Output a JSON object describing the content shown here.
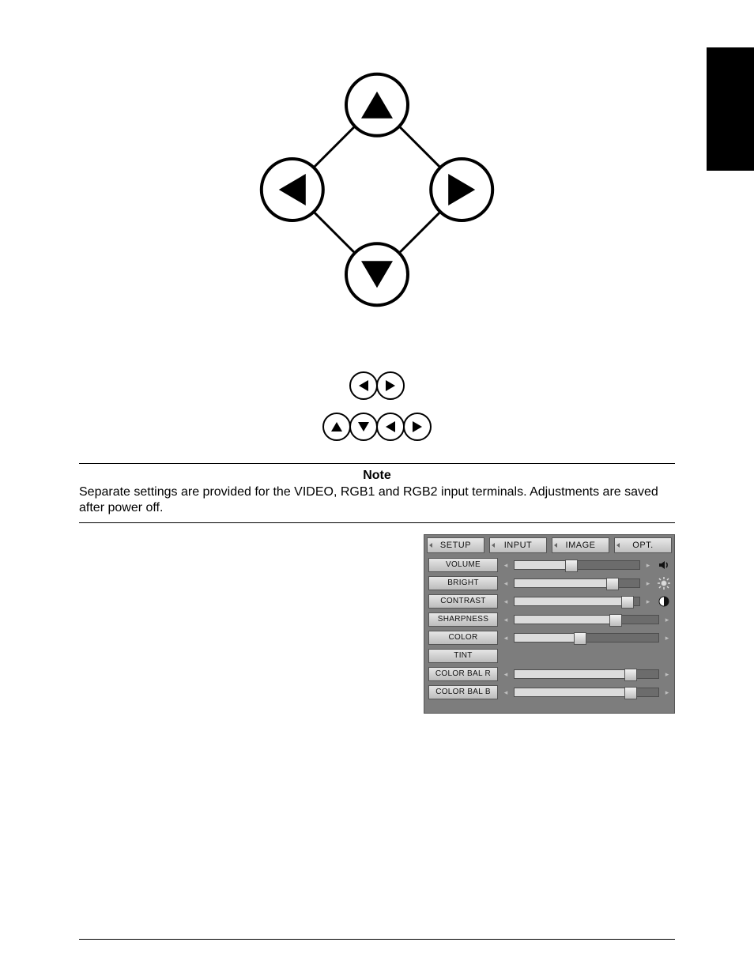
{
  "note": {
    "heading": "Note",
    "body": "Separate settings are provided for the VIDEO, RGB1 and RGB2 input terminals.  Adjustments are saved after power off."
  },
  "osd": {
    "tabs": [
      "SETUP",
      "INPUT",
      "IMAGE",
      "OPT."
    ],
    "items": [
      {
        "label": "VOLUME",
        "value": 45,
        "has_slider": true,
        "icon": "speaker"
      },
      {
        "label": "BRIGHT",
        "value": 78,
        "has_slider": true,
        "icon": "sun"
      },
      {
        "label": "CONTRAST",
        "value": 90,
        "has_slider": true,
        "icon": "contrast"
      },
      {
        "label": "SHARPNESS",
        "value": 70,
        "has_slider": true,
        "icon": null
      },
      {
        "label": "COLOR",
        "value": 45,
        "has_slider": true,
        "icon": null
      },
      {
        "label": "TINT",
        "value": null,
        "has_slider": false,
        "icon": null
      },
      {
        "label": "COLOR BAL R",
        "value": 80,
        "has_slider": true,
        "icon": null
      },
      {
        "label": "COLOR BAL B",
        "value": 80,
        "has_slider": true,
        "icon": null
      }
    ]
  }
}
